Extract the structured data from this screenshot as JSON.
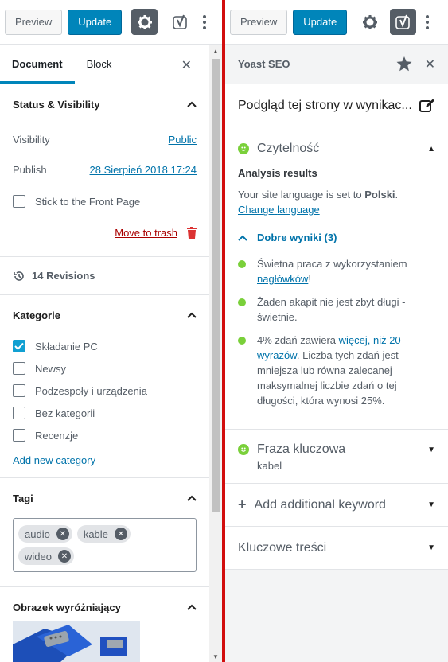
{
  "left": {
    "toolbar": {
      "preview": "Preview",
      "update": "Update"
    },
    "tabs": [
      "Document",
      "Block"
    ],
    "status": {
      "heading": "Status & Visibility",
      "visibility_label": "Visibility",
      "visibility_value": "Public",
      "publish_label": "Publish",
      "publish_value": "28 Sierpień 2018 17:24",
      "stick_label": "Stick to the Front Page",
      "trash_label": "Move to trash"
    },
    "revisions": "14 Revisions",
    "categories": {
      "heading": "Kategorie",
      "items": [
        {
          "label": "Składanie PC",
          "checked": true
        },
        {
          "label": "Newsy",
          "checked": false
        },
        {
          "label": "Podzespoły i urządzenia",
          "checked": false
        },
        {
          "label": "Bez kategorii",
          "checked": false
        },
        {
          "label": "Recenzje",
          "checked": false
        }
      ],
      "add_new": "Add new category"
    },
    "tags": {
      "heading": "Tagi",
      "items": [
        "audio",
        "kable",
        "wideo"
      ]
    },
    "featured": {
      "heading": "Obrazek wyróżniający"
    }
  },
  "right": {
    "toolbar": {
      "preview": "Preview",
      "update": "Update"
    },
    "panel_title": "Yoast SEO",
    "snippet_title": "Podgląd tej strony w wynikac...",
    "readability": {
      "title": "Czytelność",
      "analysis_heading": "Analysis results",
      "lang_text": "Your site language is set to ",
      "lang_value": "Polski",
      "lang_sep": ". ",
      "change_label": "Change",
      "language_label": "language",
      "good_heading": "Dobre wyniki (3)",
      "results": [
        {
          "pre": "Świetna praca z wykorzystaniem ",
          "link": "nagłówków",
          "post": "!"
        },
        {
          "pre": "Żaden akapit nie jest zbyt długi - świetnie.",
          "link": "",
          "post": ""
        },
        {
          "pre": "4% zdań zawiera ",
          "link": "więcej, niż 20 wyrazów",
          "post": ". Liczba tych zdań jest mniejsza lub równa zalecanej maksymalnej liczbie zdań o tej długości, która wynosi 25%."
        }
      ]
    },
    "keyphrase": {
      "title": "Fraza kluczowa",
      "value": "kabel"
    },
    "add_keyword": "Add additional keyword",
    "cornerstone": "Kluczowe treści",
    "colors": {
      "accent": "#0085ba",
      "good": "#7ad03a",
      "divider": "#d20d0d"
    }
  }
}
